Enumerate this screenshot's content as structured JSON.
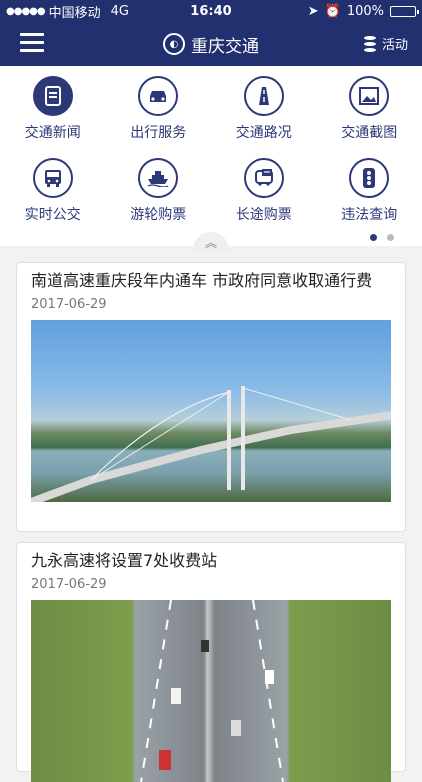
{
  "status_bar": {
    "carrier": "中国移动",
    "network": "4G",
    "time": "16:40",
    "battery": "100%",
    "battery_level": 1.0
  },
  "navbar": {
    "title": "重庆交通",
    "action_label": "活动"
  },
  "grid": [
    {
      "label": "交通新闻",
      "icon": "news-icon",
      "active": true
    },
    {
      "label": "出行服务",
      "icon": "car-icon"
    },
    {
      "label": "交通路况",
      "icon": "road-icon"
    },
    {
      "label": "交通截图",
      "icon": "screenshot-icon"
    },
    {
      "label": "实时公交",
      "icon": "bus-icon"
    },
    {
      "label": "游轮购票",
      "icon": "ship-icon"
    },
    {
      "label": "长途购票",
      "icon": "coach-icon"
    },
    {
      "label": "违法查询",
      "icon": "traffic-light-icon"
    }
  ],
  "page_indicator": {
    "pages": 2,
    "current": 1
  },
  "articles": [
    {
      "title": "南道高速重庆段年内通车 市政府同意收取通行费",
      "date": "2017-06-29",
      "image": "bridge-photo"
    },
    {
      "title": "九永高速将设置7处收费站",
      "date": "2017-06-29",
      "image": "highway-photo"
    }
  ],
  "colors": {
    "primary": "#233070",
    "accent": "#2c3877",
    "background": "#f2f2f2"
  }
}
